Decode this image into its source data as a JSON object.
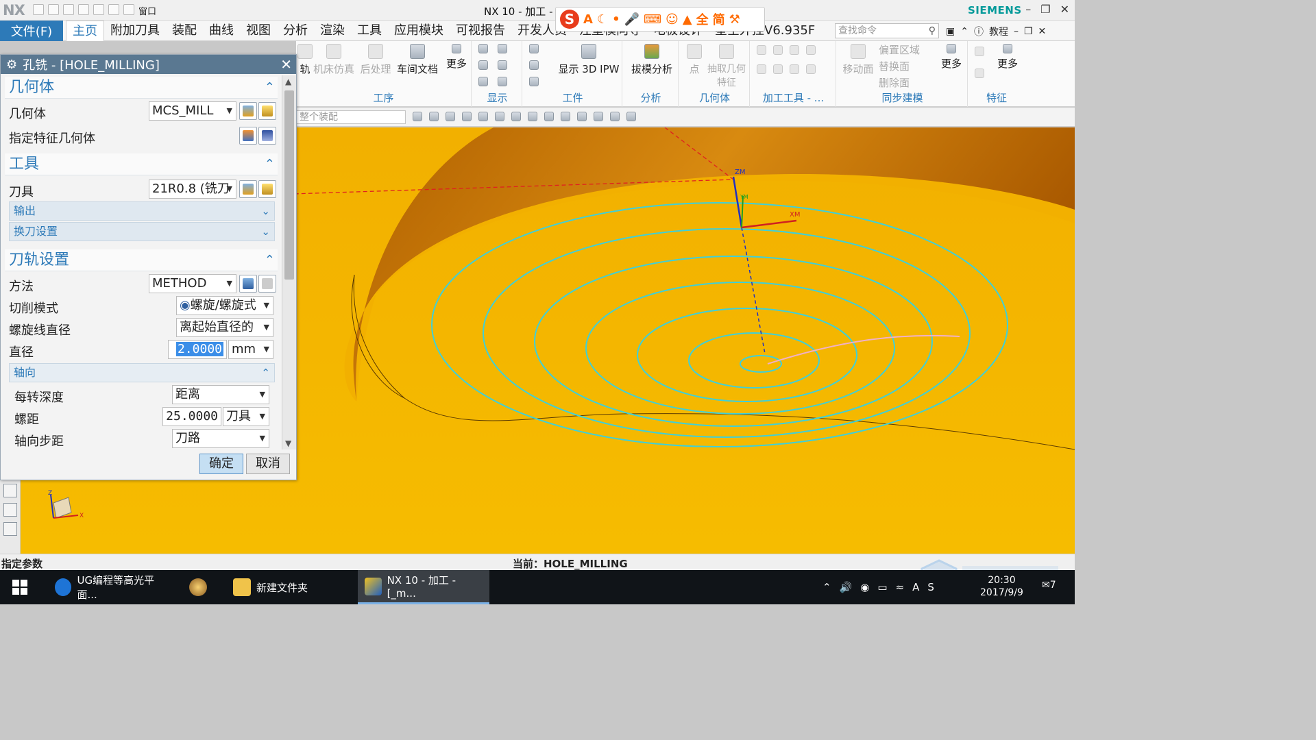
{
  "titlebar": {
    "logo": "NX",
    "window_menu": "窗口",
    "app_title": "NX 10 - 加工 - [",
    "brand": "SIEMENS"
  },
  "ime": {
    "logo": "S",
    "items": [
      "A",
      "全",
      "简"
    ]
  },
  "menubar": {
    "file_label": "文件(F)",
    "tabs": [
      "主页",
      "附加刀具",
      "装配",
      "曲线",
      "视图",
      "分析",
      "渲染",
      "工具",
      "应用模块",
      "可视报告",
      "开发人员",
      "注塑模向导",
      "电极设计",
      "星空外挂V6.935F"
    ],
    "search_placeholder": "查找命令",
    "tutorial": "教程"
  },
  "ribbon": {
    "groups": [
      {
        "name": "工序",
        "buttons": [
          "轨",
          "机床仿真",
          "后处理",
          "车间文档",
          "更多"
        ]
      },
      {
        "name": "显示",
        "buttons": []
      },
      {
        "name": "工件",
        "buttons": [
          "显示 3D IPW"
        ]
      },
      {
        "name": "分析",
        "buttons": [
          "拔模分析"
        ]
      },
      {
        "name": "几何体",
        "buttons": [
          "点",
          "抽取几何特征"
        ]
      },
      {
        "name": "加工工具 - ...",
        "buttons": []
      },
      {
        "name": "同步建模",
        "buttons": [
          "移动面",
          "偏置区域",
          "替换面",
          "删除面",
          "更多"
        ]
      },
      {
        "name": "特征",
        "buttons": [
          "更多"
        ]
      }
    ],
    "assembly_filter": "整个装配"
  },
  "dialog": {
    "title": "孔铣 - [HOLE_MILLING]",
    "sections": {
      "geometry": {
        "title": "几何体",
        "geometry_label": "几何体",
        "geometry_value": "MCS_MILL",
        "feature_label": "指定特征几何体"
      },
      "tool": {
        "title": "工具",
        "tool_label": "刀具",
        "tool_value": "21R0.8 (铣刀",
        "output": "输出",
        "tool_change": "换刀设置"
      },
      "path": {
        "title": "刀轨设置",
        "method_label": "方法",
        "method_value": "METHOD",
        "cut_mode_label": "切削模式",
        "cut_mode_value": "螺旋/螺旋式",
        "helix_label": "螺旋线直径",
        "helix_value": "离起始直径的",
        "diameter_label": "直径",
        "diameter_value": "2.0000",
        "diameter_unit": "mm",
        "axial": "轴向",
        "depth_label": "每转深度",
        "depth_value": "距离",
        "pitch_label": "螺距",
        "pitch_value": "25.0000",
        "pitch_unit": "刀具",
        "step_label": "轴向步距",
        "step_value": "刀路"
      }
    },
    "ok": "确定",
    "cancel": "取消"
  },
  "status": {
    "left": "指定参数",
    "middle": "当前：HOLE_MILLING"
  },
  "taskbar": {
    "items": [
      "UG编程等高光平面...",
      "新建文件夹",
      "NX 10 - 加工 - [_m..."
    ],
    "time": "20:30",
    "date": "2017/9/9",
    "notifications": "7"
  },
  "viewport": {
    "axis_labels": [
      "ZM",
      "XM",
      "YM"
    ],
    "triad_labels": [
      "Z",
      "X"
    ],
    "colors": {
      "background": "#F5B800",
      "wall": "#C97800",
      "toolpath": "#3FD0D8",
      "engage": "#F0B0C8"
    }
  },
  "watermark": "3D世界网 www.3dsjw.com"
}
